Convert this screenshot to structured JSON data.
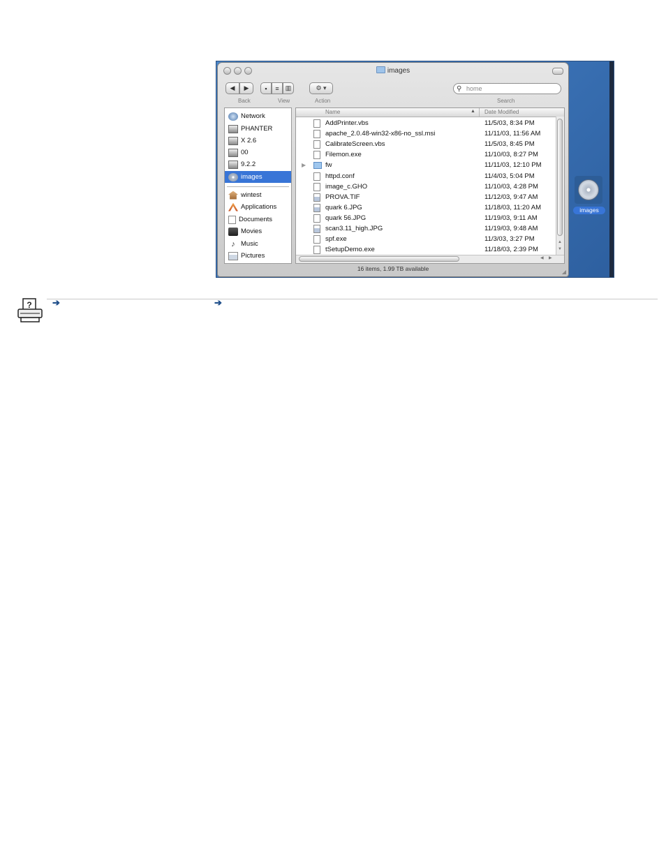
{
  "window": {
    "title": "images",
    "toolbar": {
      "back_label": "Back",
      "view_label": "View",
      "action_label": "Action",
      "search_label": "Search",
      "search_placeholder": "home"
    },
    "sidebar": {
      "devices": [
        {
          "label": "Network",
          "icon": "network-globe-icon"
        },
        {
          "label": "PHANTER",
          "icon": "hard-disk-icon"
        },
        {
          "label": "X 2.6",
          "icon": "hard-disk-icon"
        },
        {
          "label": "00",
          "icon": "hard-disk-icon"
        },
        {
          "label": "9.2.2",
          "icon": "hard-disk-icon"
        },
        {
          "label": "images",
          "icon": "disk-image-icon",
          "selected": true
        }
      ],
      "places": [
        {
          "label": "wintest",
          "icon": "home-icon"
        },
        {
          "label": "Applications",
          "icon": "applications-icon"
        },
        {
          "label": "Documents",
          "icon": "documents-icon"
        },
        {
          "label": "Movies",
          "icon": "movies-icon"
        },
        {
          "label": "Music",
          "icon": "music-icon"
        },
        {
          "label": "Pictures",
          "icon": "pictures-icon"
        }
      ]
    },
    "columns": {
      "name": "Name",
      "date": "Date Modified"
    },
    "files": [
      {
        "name": "AddPrinter.vbs",
        "date": "11/5/03, 8:34 PM",
        "kind": "doc"
      },
      {
        "name": "apache_2.0.48-win32-x86-no_ssl.msi",
        "date": "11/11/03, 11:56 AM",
        "kind": "doc"
      },
      {
        "name": "CalibrateScreen.vbs",
        "date": "11/5/03, 8:45 PM",
        "kind": "doc"
      },
      {
        "name": "Filemon.exe",
        "date": "11/10/03, 8:27 PM",
        "kind": "doc"
      },
      {
        "name": "fw",
        "date": "11/11/03, 12:10 PM",
        "kind": "folder"
      },
      {
        "name": "httpd.conf",
        "date": "11/4/03, 5:04 PM",
        "kind": "doc"
      },
      {
        "name": "image_c.GHO",
        "date": "11/10/03, 4:28 PM",
        "kind": "doc"
      },
      {
        "name": "PROVA.TIF",
        "date": "11/12/03, 9:47 AM",
        "kind": "image"
      },
      {
        "name": "quark 6.JPG",
        "date": "11/18/03, 11:20 AM",
        "kind": "image"
      },
      {
        "name": "quark 56.JPG",
        "date": "11/19/03, 9:11 AM",
        "kind": "doc"
      },
      {
        "name": "scan3.11_high.JPG",
        "date": "11/19/03, 9:48 AM",
        "kind": "image"
      },
      {
        "name": "spf.exe",
        "date": "11/3/03, 3:27 PM",
        "kind": "doc"
      },
      {
        "name": "tSetupDemo.exe",
        "date": "11/18/03, 2:39 PM",
        "kind": "doc"
      }
    ],
    "status": "16 items, 1.99 TB available"
  },
  "desktop": {
    "volume_label": "images"
  }
}
